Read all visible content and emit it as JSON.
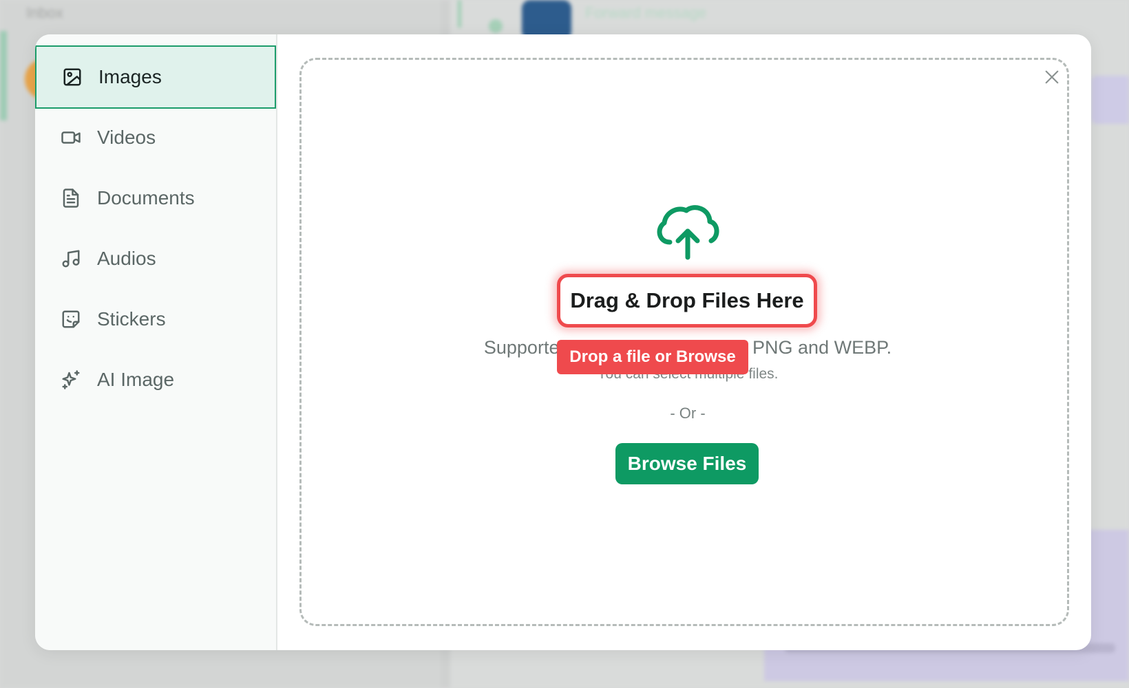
{
  "background": {
    "app_title": "Inbox",
    "forward_label": "Forward message"
  },
  "sidebar": {
    "items": [
      {
        "label": "Images",
        "icon": "image-icon",
        "active": true
      },
      {
        "label": "Videos",
        "icon": "video-icon",
        "active": false
      },
      {
        "label": "Documents",
        "icon": "document-icon",
        "active": false
      },
      {
        "label": "Audios",
        "icon": "music-note-icon",
        "active": false
      },
      {
        "label": "Stickers",
        "icon": "sticker-icon",
        "active": false
      },
      {
        "label": "AI Image",
        "icon": "sparkles-icon",
        "active": false
      }
    ]
  },
  "upload": {
    "title": "Drag & Drop Files Here",
    "supported_text": "Supported formats: JPG, JPEG, PNG and WEBP.",
    "multiple_text": "You can select multiple files.",
    "tooltip": "Drop a file or Browse",
    "or_text": "- Or -",
    "browse_label": "Browse Files"
  },
  "colors": {
    "accent_green": "#0e9a63",
    "active_bg": "#e0f2ec",
    "highlight_red": "#ef4a4d"
  }
}
